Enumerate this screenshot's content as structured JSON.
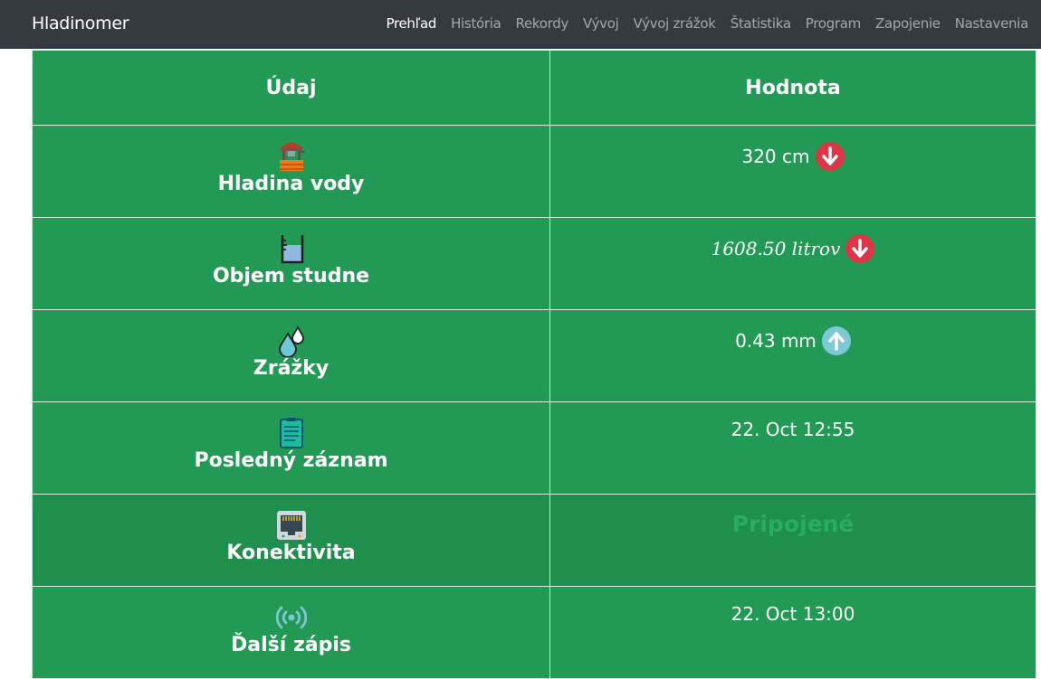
{
  "app": {
    "brand": "Hladinomer"
  },
  "nav": {
    "items": [
      "Prehľad",
      "História",
      "Rekordy",
      "Vývoj",
      "Vývoj zrážok",
      "Štatistika",
      "Program",
      "Zapojenie",
      "Nastavenia"
    ]
  },
  "table": {
    "headers": {
      "name": "Údaj",
      "value": "Hodnota"
    },
    "rows": [
      {
        "label": "Hladina vody",
        "value": "320 cm",
        "trend": "down"
      },
      {
        "label": "Objem studne",
        "value": "1608.50 litrov",
        "trend": "down"
      },
      {
        "label": "Zrážky",
        "value": "0.43 mm",
        "trend": "up"
      },
      {
        "label": "Posledný záznam",
        "value": "22. Oct 12:55"
      },
      {
        "label": "Konektivita",
        "value": "Pripojené"
      },
      {
        "label": "Ďalší zápis",
        "value": "22. Oct 13:00"
      }
    ]
  },
  "colors": {
    "table_bg": "#229954",
    "trend_down": "#dc3545",
    "trend_up": "#7ec8d6",
    "connected": "#27ae60"
  }
}
